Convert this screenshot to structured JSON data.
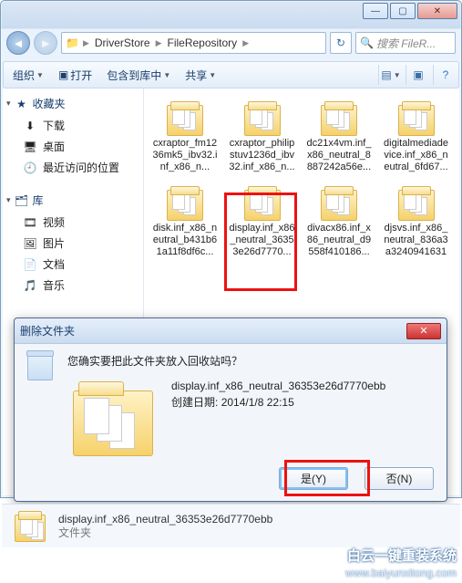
{
  "address": {
    "seg1": "DriverStore",
    "seg2": "FileRepository"
  },
  "search": {
    "placeholder": "搜索 FileR..."
  },
  "toolbar": {
    "organize": "组织",
    "open": "打开",
    "include": "包含到库中",
    "share": "共享"
  },
  "sidebar": {
    "fav": {
      "header": "收藏夹",
      "items": [
        "下载",
        "桌面",
        "最近访问的位置"
      ]
    },
    "lib": {
      "header": "库",
      "items": [
        "视频",
        "图片",
        "文档",
        "音乐"
      ]
    }
  },
  "files": {
    "row1": [
      {
        "name": "cxraptor_fm1236mk5_ibv32.inf_x86_n..."
      },
      {
        "name": "cxraptor_philipstuv1236d_ibv32.inf_x86_n..."
      },
      {
        "name": "dc21x4vm.inf_x86_neutral_8887242a56e..."
      },
      {
        "name": "digitalmediadevice.inf_x86_neutral_6fd67..."
      }
    ],
    "row2": [
      {
        "name": "disk.inf_x86_neutral_b431b61a11f8df6c..."
      },
      {
        "name": "display.inf_x86_neutral_36353e26d7770..."
      },
      {
        "name": "divacx86.inf_x86_neutral_d9558f410186..."
      },
      {
        "name": "djsvs.inf_x86_neutral_836a3a3240941631"
      }
    ]
  },
  "dialog": {
    "title": "删除文件夹",
    "question": "您确实要把此文件夹放入回收站吗？",
    "filename": "display.inf_x86_neutral_36353e26d7770ebb",
    "created_label": "创建日期:",
    "created_value": "2014/1/8 22:15",
    "yes": "是(Y)",
    "no": "否(N)"
  },
  "status": {
    "name": "display.inf_x86_neutral_36353e26d7770ebb",
    "type": "文件夹"
  },
  "watermark": {
    "brand": "白云一键重装系统",
    "url": "www.baiyunxitong.com"
  }
}
